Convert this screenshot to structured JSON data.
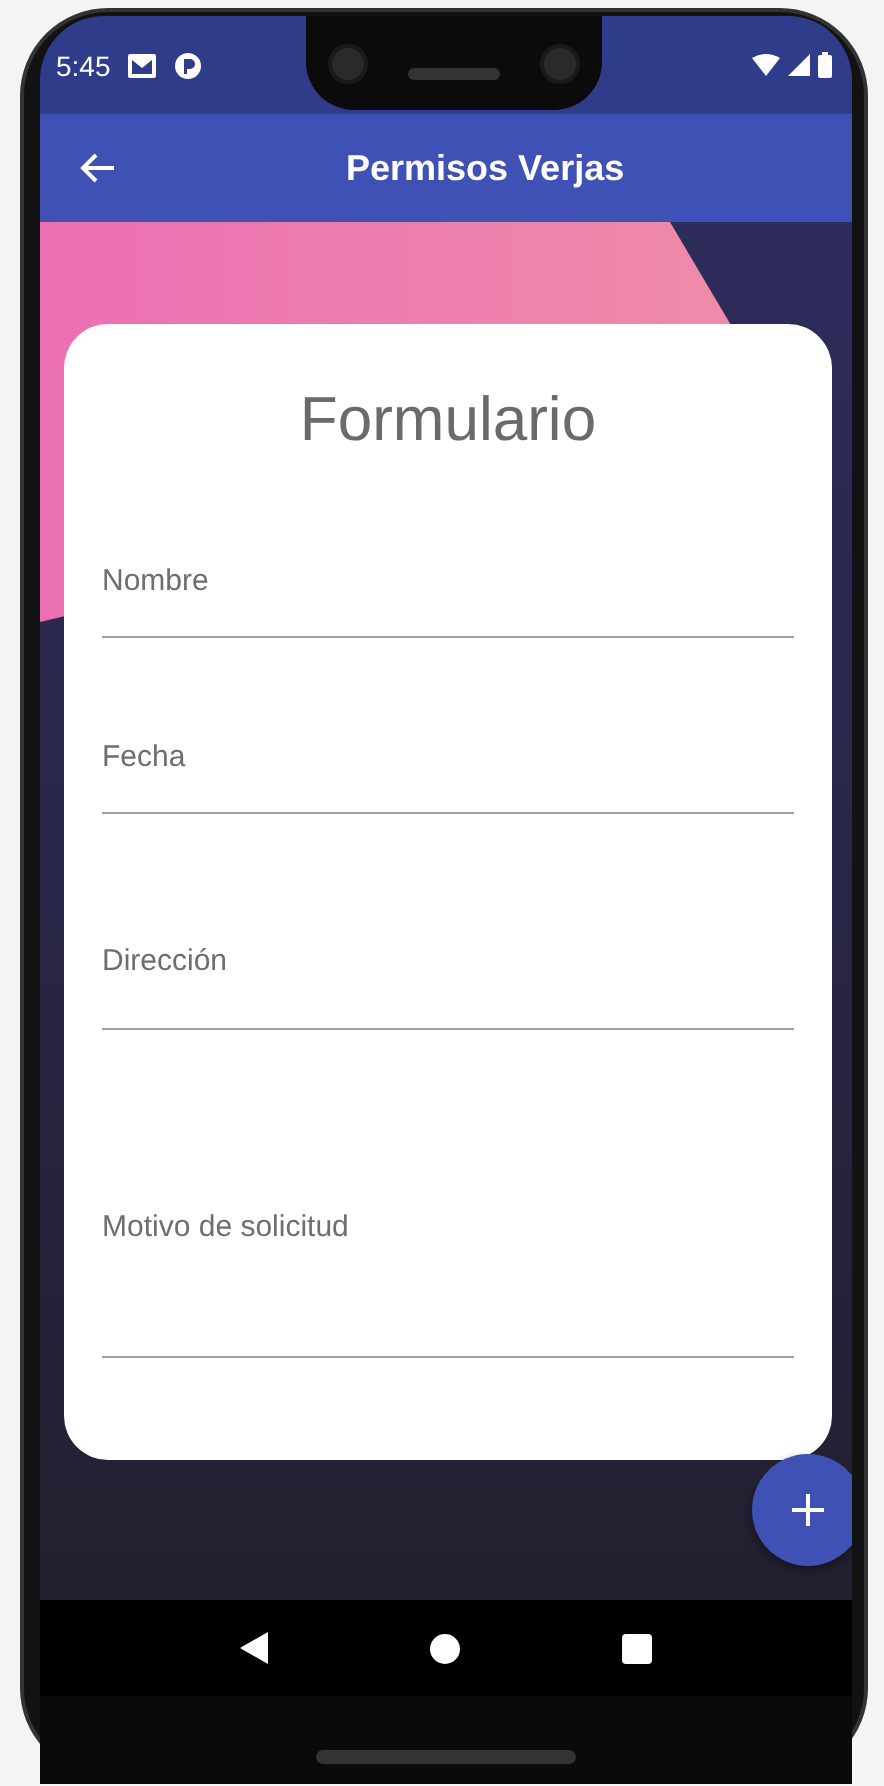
{
  "status_bar": {
    "time": "5:45"
  },
  "app_bar": {
    "title": "Permisos Verjas"
  },
  "form": {
    "title": "Formulario",
    "fields": [
      {
        "placeholder": "Nombre",
        "kind": "line"
      },
      {
        "placeholder": "Fecha",
        "kind": "line"
      },
      {
        "placeholder": "Dirección",
        "kind": "line"
      },
      {
        "placeholder": "Motivo de solicitud",
        "kind": "multiline"
      }
    ]
  }
}
